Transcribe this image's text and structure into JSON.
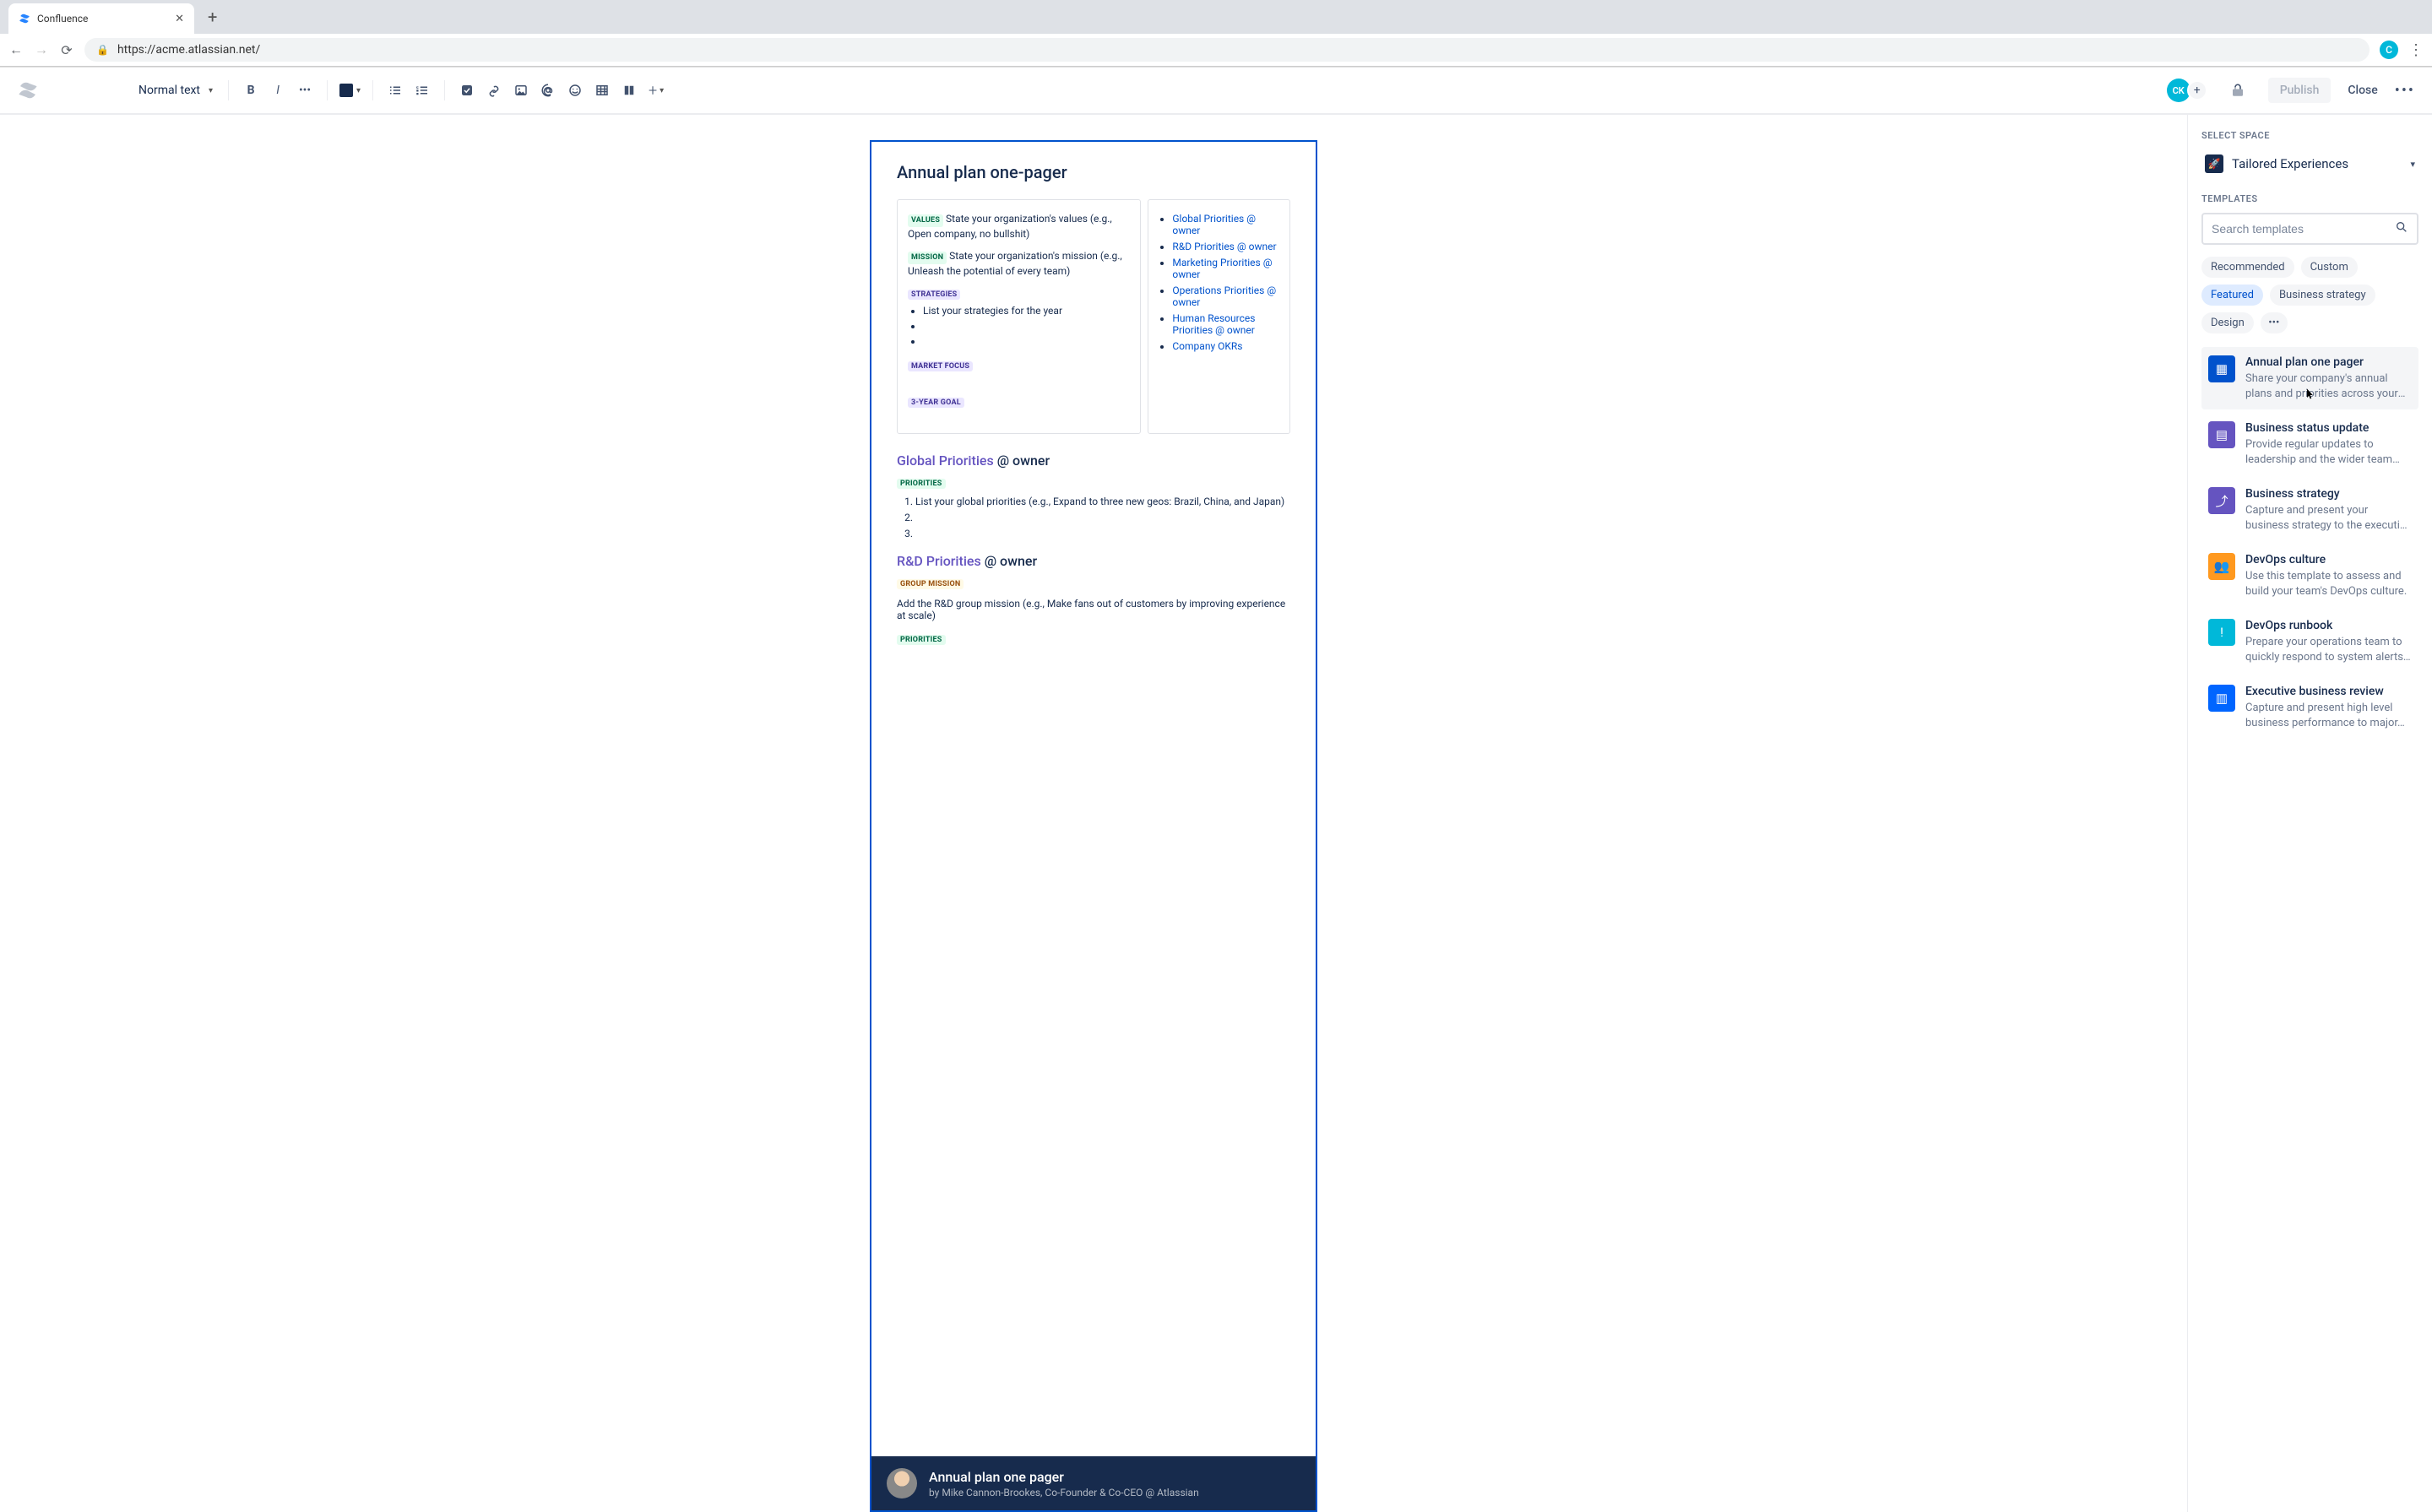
{
  "browser": {
    "tab_title": "Confluence",
    "url": "https://acme.atlassian.net/",
    "profile_initial": "C"
  },
  "toolbar": {
    "text_style": "Normal text",
    "avatar_initials": "CK",
    "publish_label": "Publish",
    "close_label": "Close"
  },
  "page": {
    "title": "Annual plan one-pager",
    "values_badge": "VALUES",
    "values_text": "State your organization's values (e.g., Open company, no bullshit)",
    "mission_badge": "MISSION",
    "mission_text": "State your organization's mission (e.g., Unleash the potential of every team)",
    "strategies_badge": "STRATEGIES",
    "strategies_item": "List your strategies for the year",
    "marketfocus_badge": "MARKET FOCUS",
    "goal_badge": "3-YEAR GOAL",
    "links": [
      "Global Priorities @ owner",
      "R&D Priorities @ owner",
      "Marketing Priorities @ owner",
      "Operations Priorities @ owner",
      "Human Resources Priorities @ owner",
      "Company OKRs"
    ],
    "global_heading_link": "Global Priorities",
    "global_heading_owner": "@ owner",
    "priorities_badge": "PRIORITIES",
    "global_item1": "List your global priorities (e.g., Expand to three new geos: Brazil, China, and Japan)",
    "rd_heading_link": "R&D Priorities",
    "rd_heading_owner": "@ owner",
    "groupmission_badge": "GROUP MISSION",
    "rd_text": "Add the R&D group mission (e.g., Make fans out of customers by improving experience at scale)",
    "priorities_badge2": "PRIORITIES"
  },
  "attribution": {
    "title": "Annual plan one pager",
    "subtitle": "by Mike Cannon-Brookes, Co-Founder & Co-CEO @ Atlassian"
  },
  "sidebar": {
    "select_space_label": "SELECT SPACE",
    "space_name": "Tailored Experiences",
    "templates_label": "TEMPLATES",
    "search_placeholder": "Search templates",
    "chips": {
      "recommended": "Recommended",
      "custom": "Custom",
      "featured": "Featured",
      "business_strategy": "Business strategy",
      "design": "Design"
    },
    "templates": [
      {
        "title": "Annual plan one pager",
        "desc": "Share your company's annual plans and priorities across your entire…",
        "color": "ti-blue",
        "icon": "▦"
      },
      {
        "title": "Business status update",
        "desc": "Provide regular updates to leadership and the wider team on…",
        "color": "ti-purple",
        "icon": "▤"
      },
      {
        "title": "Business strategy",
        "desc": "Capture and present your business strategy to the executive team and…",
        "color": "ti-purple",
        "icon": "⤴"
      },
      {
        "title": "DevOps culture",
        "desc": "Use this template to assess and build your team's DevOps culture.",
        "color": "ti-orange",
        "icon": "👥"
      },
      {
        "title": "DevOps runbook",
        "desc": "Prepare your operations team to quickly respond to system alerts…",
        "color": "ti-teal",
        "icon": "!"
      },
      {
        "title": "Executive business review",
        "desc": "Capture and present high level business performance to major…",
        "color": "ti-royal",
        "icon": "▥"
      }
    ]
  }
}
